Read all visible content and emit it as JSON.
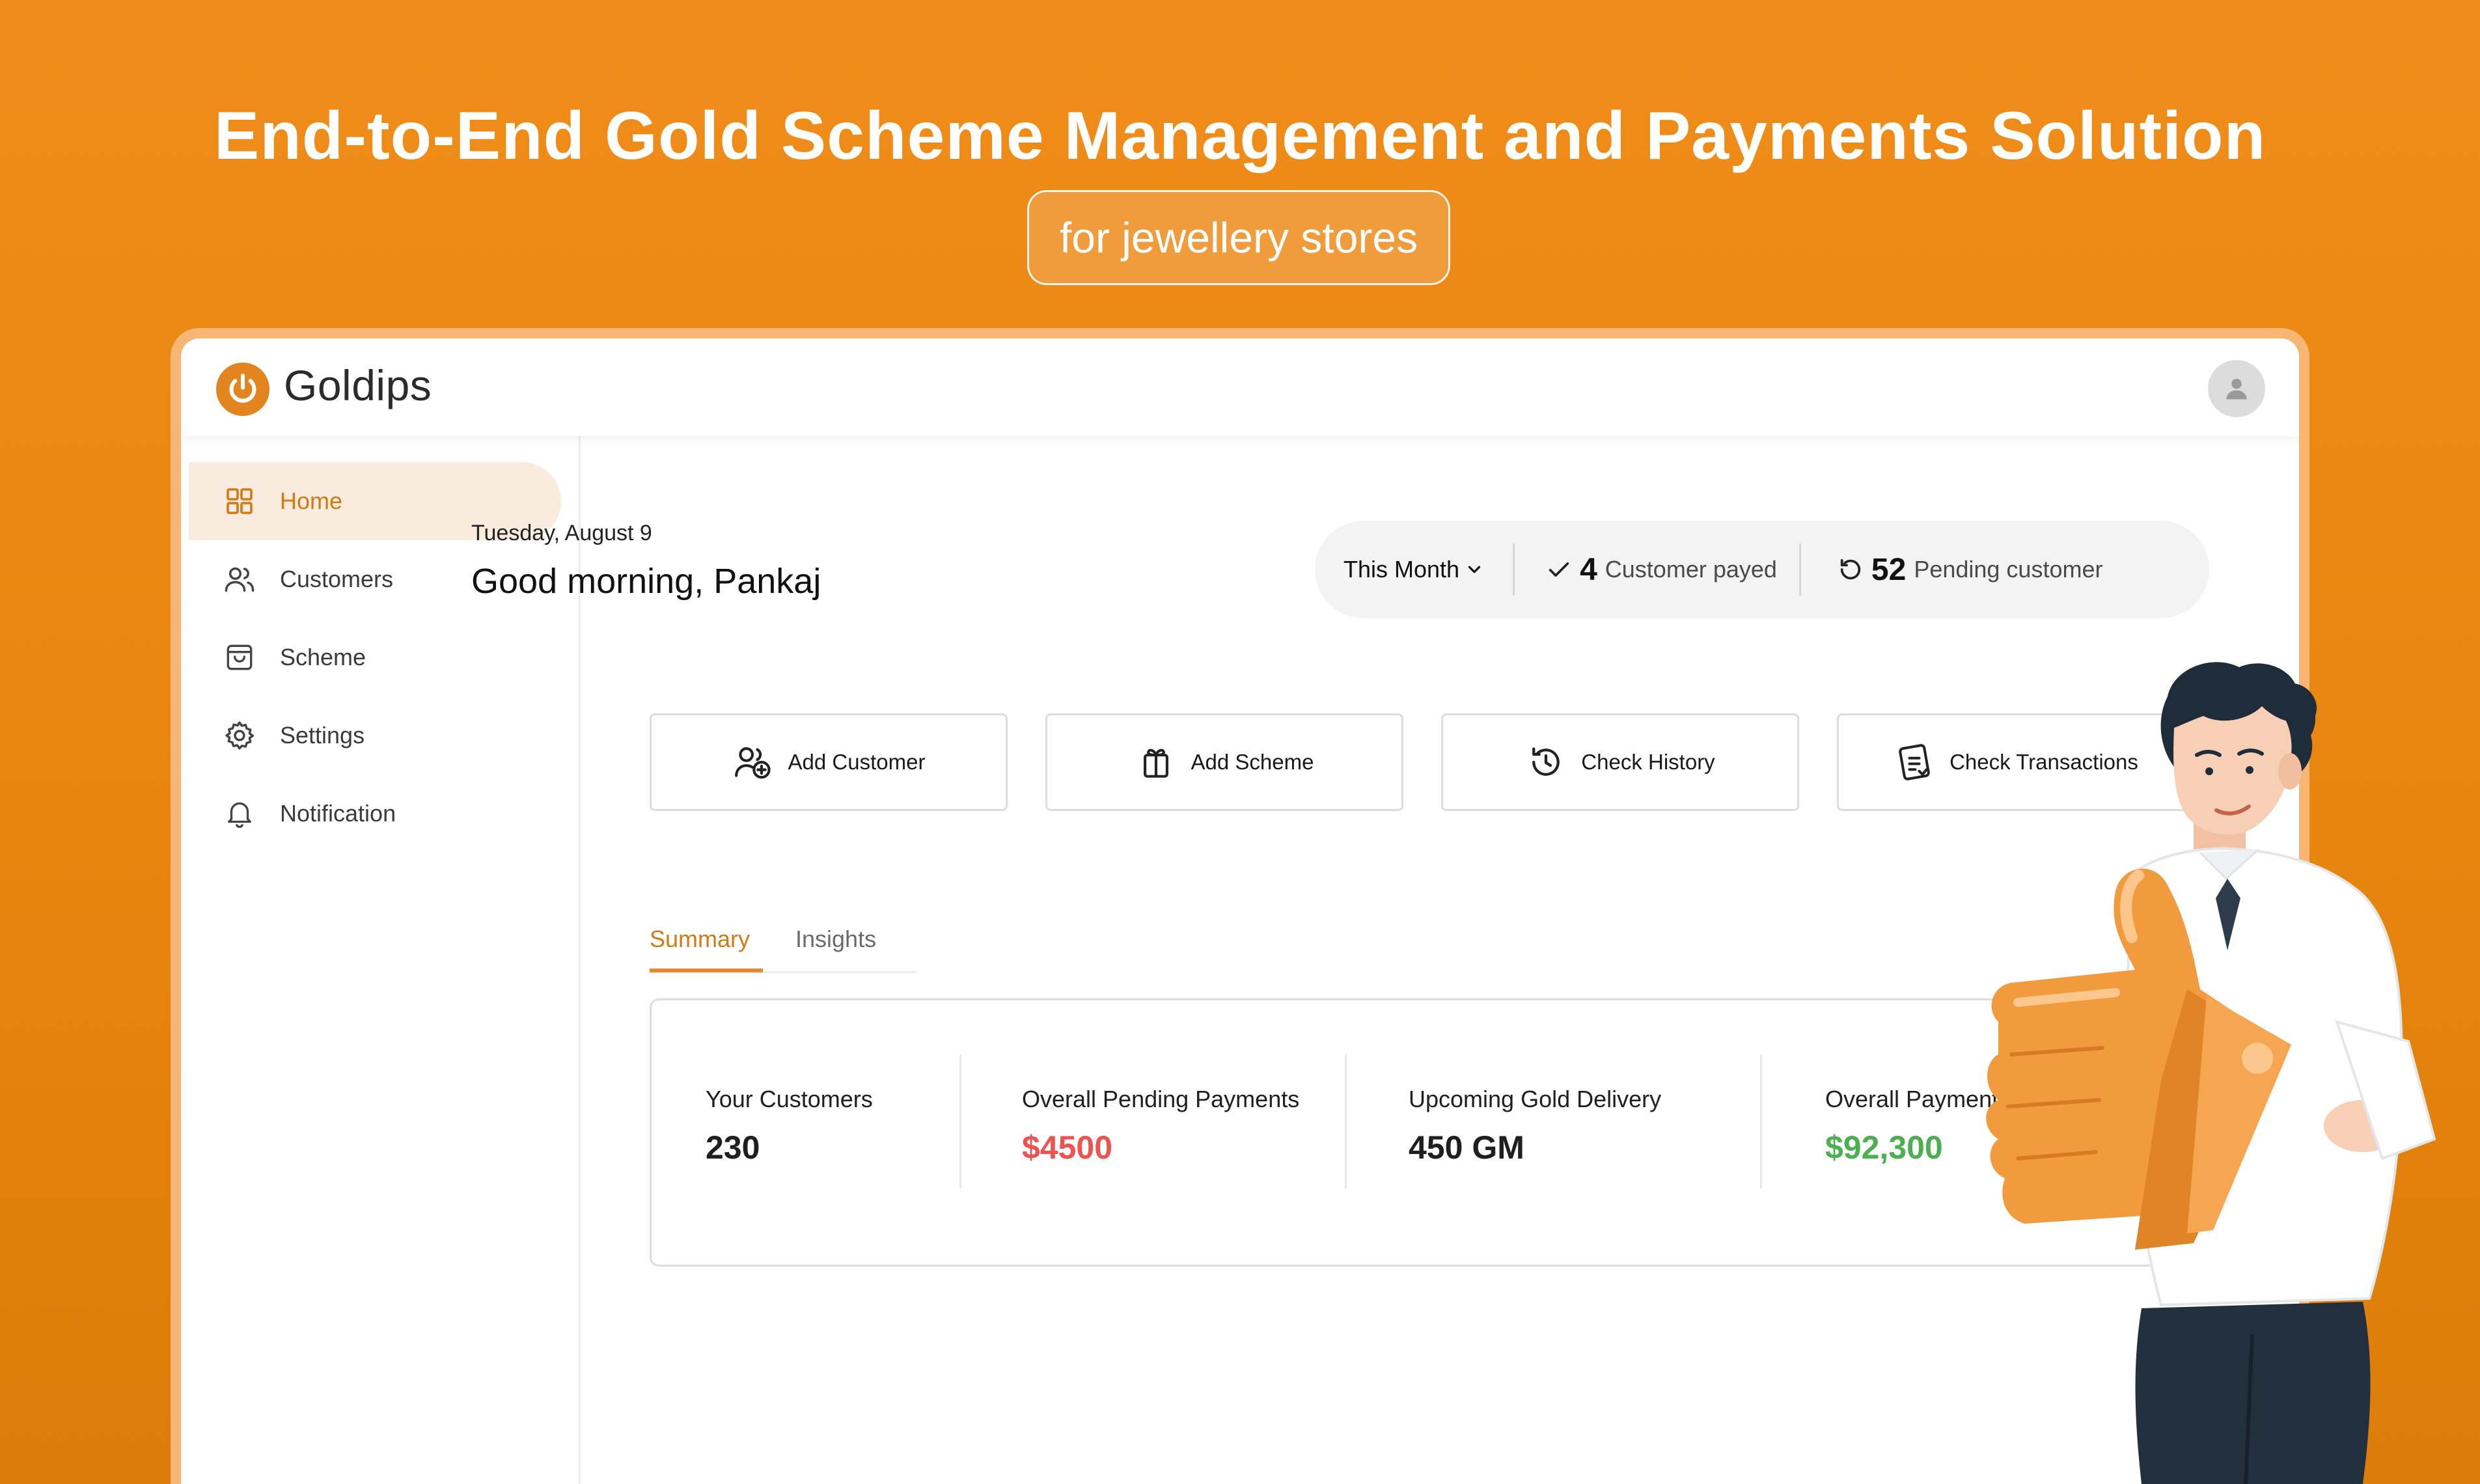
{
  "hero": {
    "title": "End-to-End Gold Scheme Management and Payments Solution",
    "subtitle": "for jewellery stores"
  },
  "app": {
    "brand": "Goldips",
    "logo_icon": "power-icon",
    "avatar_icon": "user-icon"
  },
  "sidebar": {
    "items": [
      {
        "label": "Home",
        "icon": "grid-icon",
        "active": true
      },
      {
        "label": "Customers",
        "icon": "users-icon",
        "active": false
      },
      {
        "label": "Scheme",
        "icon": "bag-icon",
        "active": false
      },
      {
        "label": "Settings",
        "icon": "gear-icon",
        "active": false
      },
      {
        "label": "Notification",
        "icon": "bell-icon",
        "active": false
      }
    ]
  },
  "header": {
    "date": "Tuesday, August 9",
    "greeting": "Good morning, Pankaj"
  },
  "stats": {
    "period": "This Month",
    "payed_count": "4",
    "payed_label": "Customer payed",
    "pending_count": "52",
    "pending_label": "Pending customer"
  },
  "actions": [
    {
      "label": "Add Customer",
      "icon": "add-user-icon"
    },
    {
      "label": "Add Scheme",
      "icon": "gift-icon"
    },
    {
      "label": "Check History",
      "icon": "history-icon"
    },
    {
      "label": "Check Transactions",
      "icon": "transactions-icon"
    }
  ],
  "tabs": [
    {
      "label": "Summary",
      "active": true
    },
    {
      "label": "Insights",
      "active": false
    }
  ],
  "summary": [
    {
      "label": "Your Customers",
      "value": "230",
      "color": "#1a1a1a"
    },
    {
      "label": "Overall Pending Payments",
      "value": "$4500",
      "color": "#ef5350"
    },
    {
      "label": "Upcoming Gold Delivery",
      "value": "450 GM",
      "color": "#1a1a1a"
    },
    {
      "label": "Overall Payment Received",
      "value": "$92,300",
      "color": "#4caf50"
    }
  ],
  "colors": {
    "accent": "#e2851e",
    "background": "#ee8918",
    "active_nav": "#f9ebdd"
  }
}
